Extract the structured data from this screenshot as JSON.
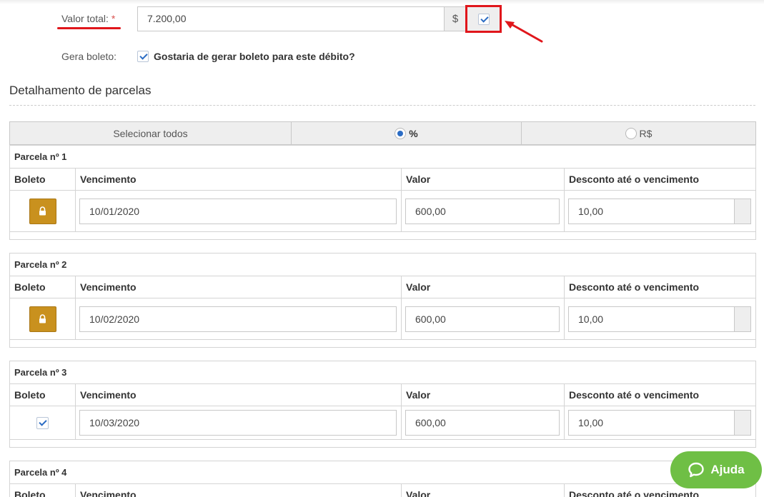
{
  "form": {
    "valor_total_label": "Valor total:",
    "required_mark": "*",
    "valor_total_value": "7.200,00",
    "currency_symbol": "$",
    "gera_boleto_label": "Gera boleto:",
    "gera_boleto_text": "Gostaria de gerar boleto para este débito?"
  },
  "section": {
    "title": "Detalhamento de parcelas"
  },
  "selector": {
    "select_all": "Selecionar todos",
    "percent_label": "%",
    "currency_label": "R$",
    "selected": "%"
  },
  "columns": {
    "boleto": "Boleto",
    "vencimento": "Vencimento",
    "valor": "Valor",
    "desconto": "Desconto até o vencimento"
  },
  "parcelas": [
    {
      "title": "Parcela nº 1",
      "boleto_state": "locked",
      "vencimento": "10/01/2020",
      "valor": "600,00",
      "desconto": "10,00"
    },
    {
      "title": "Parcela nº 2",
      "boleto_state": "locked",
      "vencimento": "10/02/2020",
      "valor": "600,00",
      "desconto": "10,00"
    },
    {
      "title": "Parcela nº 3",
      "boleto_state": "checked",
      "vencimento": "10/03/2020",
      "valor": "600,00",
      "desconto": "10,00"
    },
    {
      "title": "Parcela nº 4",
      "boleto_state": "",
      "vencimento": "",
      "valor": "",
      "desconto": ""
    }
  ],
  "help": {
    "label": "Ajuda"
  },
  "colors": {
    "highlight": "#e0161b",
    "lock_button": "#c9911e",
    "help_button": "#6fbf45",
    "checkbox_accent": "#2b6cc4"
  }
}
